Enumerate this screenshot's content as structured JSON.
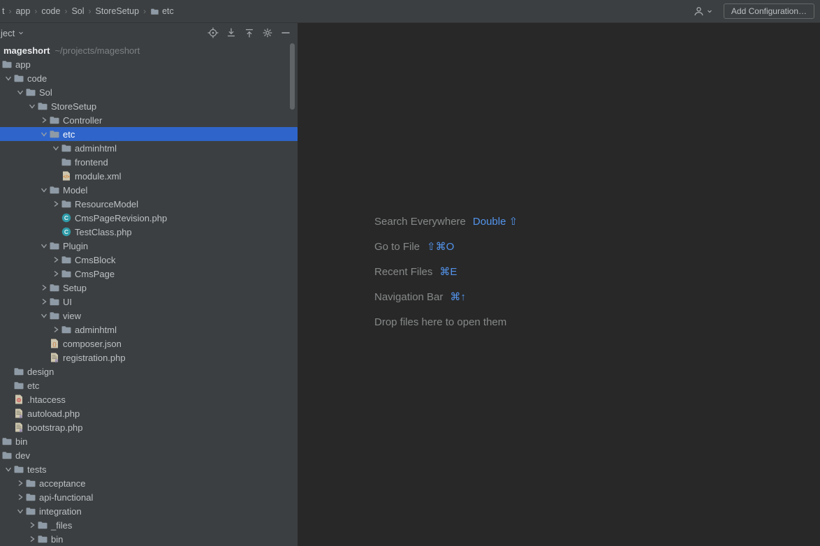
{
  "colors": {
    "selection": "#2f65ca",
    "shortcut_accent": "#5394ec",
    "panel_bg": "#3c3f41",
    "editor_bg": "#282828"
  },
  "titlebar": {
    "breadcrumbs": [
      {
        "label": "t"
      },
      {
        "label": "app"
      },
      {
        "label": "code"
      },
      {
        "label": "Sol"
      },
      {
        "label": "StoreSetup"
      },
      {
        "label": "etc",
        "icon": "folder"
      }
    ],
    "icons": [
      "user-dropdown-icon"
    ],
    "add_configuration_label": "Add Configuration…"
  },
  "project_panel": {
    "title": "ject",
    "toolbar_icons": [
      "locate-icon",
      "collapse-all-icon",
      "expand-all-icon",
      "settings-gear-icon",
      "hide-panel-icon"
    ],
    "tree": [
      {
        "name": "mageshort",
        "suffix": "~/projects/mageshort",
        "depth": 0,
        "icon": "folder",
        "state": "expanded",
        "bold": true
      },
      {
        "name": "app",
        "depth": 1,
        "icon": "folder",
        "state": "expanded"
      },
      {
        "name": "code",
        "depth": 2,
        "icon": "folder",
        "state": "expanded"
      },
      {
        "name": "Sol",
        "depth": 3,
        "icon": "folder",
        "state": "expanded"
      },
      {
        "name": "StoreSetup",
        "depth": 4,
        "icon": "folder",
        "state": "expanded"
      },
      {
        "name": "Controller",
        "depth": 5,
        "icon": "folder",
        "state": "collapsed"
      },
      {
        "name": "etc",
        "depth": 5,
        "icon": "folder",
        "state": "expanded",
        "selected": true
      },
      {
        "name": "adminhtml",
        "depth": 6,
        "icon": "folder",
        "state": "expanded"
      },
      {
        "name": "frontend",
        "depth": 6,
        "icon": "folder",
        "state": "none"
      },
      {
        "name": "module.xml",
        "depth": 6,
        "icon": "xml",
        "state": "none"
      },
      {
        "name": "Model",
        "depth": 5,
        "icon": "folder",
        "state": "expanded"
      },
      {
        "name": "ResourceModel",
        "depth": 6,
        "icon": "folder",
        "state": "collapsed"
      },
      {
        "name": "CmsPageRevision.php",
        "depth": 6,
        "icon": "php-class",
        "state": "none"
      },
      {
        "name": "TestClass.php",
        "depth": 6,
        "icon": "php-class",
        "state": "none"
      },
      {
        "name": "Plugin",
        "depth": 5,
        "icon": "folder",
        "state": "expanded"
      },
      {
        "name": "CmsBlock",
        "depth": 6,
        "icon": "folder",
        "state": "collapsed"
      },
      {
        "name": "CmsPage",
        "depth": 6,
        "icon": "folder",
        "state": "collapsed"
      },
      {
        "name": "Setup",
        "depth": 5,
        "icon": "folder",
        "state": "collapsed"
      },
      {
        "name": "UI",
        "depth": 5,
        "icon": "folder",
        "state": "collapsed"
      },
      {
        "name": "view",
        "depth": 5,
        "icon": "folder",
        "state": "expanded"
      },
      {
        "name": "adminhtml",
        "depth": 6,
        "icon": "folder",
        "state": "collapsed"
      },
      {
        "name": "composer.json",
        "depth": 5,
        "icon": "json",
        "state": "none"
      },
      {
        "name": "registration.php",
        "depth": 5,
        "icon": "php",
        "state": "none"
      },
      {
        "name": "design",
        "depth": 2,
        "icon": "folder",
        "state": "none"
      },
      {
        "name": "etc",
        "depth": 2,
        "icon": "folder",
        "state": "none"
      },
      {
        "name": ".htaccess",
        "depth": 2,
        "icon": "htaccess",
        "state": "none"
      },
      {
        "name": "autoload.php",
        "depth": 2,
        "icon": "php",
        "state": "none"
      },
      {
        "name": "bootstrap.php",
        "depth": 2,
        "icon": "php",
        "state": "none"
      },
      {
        "name": "bin",
        "depth": 1,
        "icon": "folder",
        "state": "none"
      },
      {
        "name": "dev",
        "depth": 1,
        "icon": "folder",
        "state": "expanded"
      },
      {
        "name": "tests",
        "depth": 2,
        "icon": "folder",
        "state": "expanded"
      },
      {
        "name": "acceptance",
        "depth": 3,
        "icon": "folder",
        "state": "collapsed"
      },
      {
        "name": "api-functional",
        "depth": 3,
        "icon": "folder",
        "state": "collapsed"
      },
      {
        "name": "integration",
        "depth": 3,
        "icon": "folder",
        "state": "expanded"
      },
      {
        "name": "_files",
        "depth": 4,
        "icon": "folder",
        "state": "collapsed"
      },
      {
        "name": "bin",
        "depth": 4,
        "icon": "folder",
        "state": "collapsed"
      }
    ]
  },
  "editor": {
    "shortcuts": [
      {
        "label": "Search Everywhere",
        "keys": "Double ⇧"
      },
      {
        "label": "Go to File",
        "keys": "⇧⌘O"
      },
      {
        "label": "Recent Files",
        "keys": "⌘E"
      },
      {
        "label": "Navigation Bar",
        "keys": "⌘↑"
      },
      {
        "label": "Drop files here to open them",
        "keys": ""
      }
    ]
  }
}
